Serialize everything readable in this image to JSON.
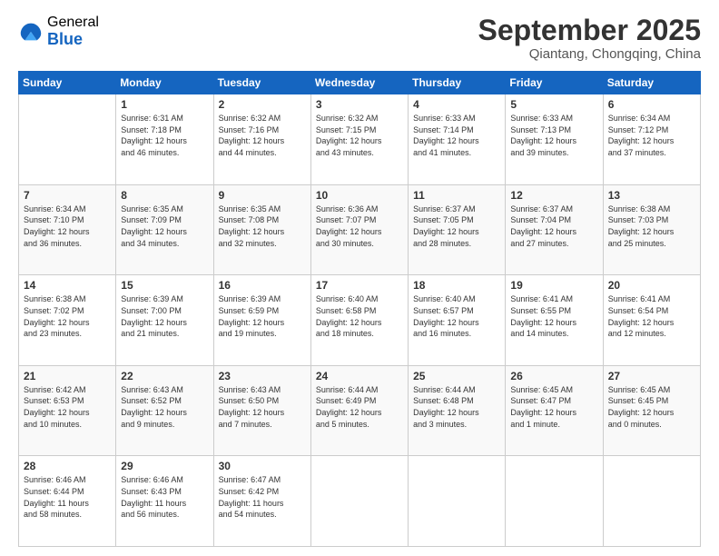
{
  "logo": {
    "general": "General",
    "blue": "Blue"
  },
  "header": {
    "month": "September 2025",
    "location": "Qiantang, Chongqing, China"
  },
  "days_of_week": [
    "Sunday",
    "Monday",
    "Tuesday",
    "Wednesday",
    "Thursday",
    "Friday",
    "Saturday"
  ],
  "weeks": [
    [
      {
        "day": "",
        "info": ""
      },
      {
        "day": "1",
        "info": "Sunrise: 6:31 AM\nSunset: 7:18 PM\nDaylight: 12 hours\nand 46 minutes."
      },
      {
        "day": "2",
        "info": "Sunrise: 6:32 AM\nSunset: 7:16 PM\nDaylight: 12 hours\nand 44 minutes."
      },
      {
        "day": "3",
        "info": "Sunrise: 6:32 AM\nSunset: 7:15 PM\nDaylight: 12 hours\nand 43 minutes."
      },
      {
        "day": "4",
        "info": "Sunrise: 6:33 AM\nSunset: 7:14 PM\nDaylight: 12 hours\nand 41 minutes."
      },
      {
        "day": "5",
        "info": "Sunrise: 6:33 AM\nSunset: 7:13 PM\nDaylight: 12 hours\nand 39 minutes."
      },
      {
        "day": "6",
        "info": "Sunrise: 6:34 AM\nSunset: 7:12 PM\nDaylight: 12 hours\nand 37 minutes."
      }
    ],
    [
      {
        "day": "7",
        "info": "Sunrise: 6:34 AM\nSunset: 7:10 PM\nDaylight: 12 hours\nand 36 minutes."
      },
      {
        "day": "8",
        "info": "Sunrise: 6:35 AM\nSunset: 7:09 PM\nDaylight: 12 hours\nand 34 minutes."
      },
      {
        "day": "9",
        "info": "Sunrise: 6:35 AM\nSunset: 7:08 PM\nDaylight: 12 hours\nand 32 minutes."
      },
      {
        "day": "10",
        "info": "Sunrise: 6:36 AM\nSunset: 7:07 PM\nDaylight: 12 hours\nand 30 minutes."
      },
      {
        "day": "11",
        "info": "Sunrise: 6:37 AM\nSunset: 7:05 PM\nDaylight: 12 hours\nand 28 minutes."
      },
      {
        "day": "12",
        "info": "Sunrise: 6:37 AM\nSunset: 7:04 PM\nDaylight: 12 hours\nand 27 minutes."
      },
      {
        "day": "13",
        "info": "Sunrise: 6:38 AM\nSunset: 7:03 PM\nDaylight: 12 hours\nand 25 minutes."
      }
    ],
    [
      {
        "day": "14",
        "info": "Sunrise: 6:38 AM\nSunset: 7:02 PM\nDaylight: 12 hours\nand 23 minutes."
      },
      {
        "day": "15",
        "info": "Sunrise: 6:39 AM\nSunset: 7:00 PM\nDaylight: 12 hours\nand 21 minutes."
      },
      {
        "day": "16",
        "info": "Sunrise: 6:39 AM\nSunset: 6:59 PM\nDaylight: 12 hours\nand 19 minutes."
      },
      {
        "day": "17",
        "info": "Sunrise: 6:40 AM\nSunset: 6:58 PM\nDaylight: 12 hours\nand 18 minutes."
      },
      {
        "day": "18",
        "info": "Sunrise: 6:40 AM\nSunset: 6:57 PM\nDaylight: 12 hours\nand 16 minutes."
      },
      {
        "day": "19",
        "info": "Sunrise: 6:41 AM\nSunset: 6:55 PM\nDaylight: 12 hours\nand 14 minutes."
      },
      {
        "day": "20",
        "info": "Sunrise: 6:41 AM\nSunset: 6:54 PM\nDaylight: 12 hours\nand 12 minutes."
      }
    ],
    [
      {
        "day": "21",
        "info": "Sunrise: 6:42 AM\nSunset: 6:53 PM\nDaylight: 12 hours\nand 10 minutes."
      },
      {
        "day": "22",
        "info": "Sunrise: 6:43 AM\nSunset: 6:52 PM\nDaylight: 12 hours\nand 9 minutes."
      },
      {
        "day": "23",
        "info": "Sunrise: 6:43 AM\nSunset: 6:50 PM\nDaylight: 12 hours\nand 7 minutes."
      },
      {
        "day": "24",
        "info": "Sunrise: 6:44 AM\nSunset: 6:49 PM\nDaylight: 12 hours\nand 5 minutes."
      },
      {
        "day": "25",
        "info": "Sunrise: 6:44 AM\nSunset: 6:48 PM\nDaylight: 12 hours\nand 3 minutes."
      },
      {
        "day": "26",
        "info": "Sunrise: 6:45 AM\nSunset: 6:47 PM\nDaylight: 12 hours\nand 1 minute."
      },
      {
        "day": "27",
        "info": "Sunrise: 6:45 AM\nSunset: 6:45 PM\nDaylight: 12 hours\nand 0 minutes."
      }
    ],
    [
      {
        "day": "28",
        "info": "Sunrise: 6:46 AM\nSunset: 6:44 PM\nDaylight: 11 hours\nand 58 minutes."
      },
      {
        "day": "29",
        "info": "Sunrise: 6:46 AM\nSunset: 6:43 PM\nDaylight: 11 hours\nand 56 minutes."
      },
      {
        "day": "30",
        "info": "Sunrise: 6:47 AM\nSunset: 6:42 PM\nDaylight: 11 hours\nand 54 minutes."
      },
      {
        "day": "",
        "info": ""
      },
      {
        "day": "",
        "info": ""
      },
      {
        "day": "",
        "info": ""
      },
      {
        "day": "",
        "info": ""
      }
    ]
  ]
}
